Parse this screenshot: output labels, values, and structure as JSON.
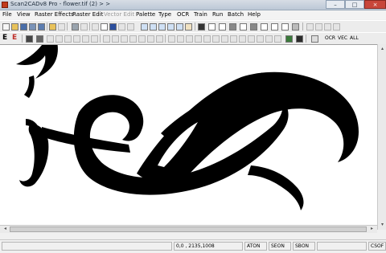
{
  "window": {
    "title": "Scan2CADv8 Pro - flower.tif (2) > >",
    "minimize_glyph": "–",
    "maximize_glyph": "□",
    "close_glyph": "×"
  },
  "menu": {
    "items": [
      {
        "label": "File",
        "enabled": true
      },
      {
        "label": "View",
        "enabled": true
      },
      {
        "label": "Raster Effects",
        "enabled": true
      },
      {
        "label": "Raster Edit",
        "enabled": true
      },
      {
        "label": "Vector Edit",
        "enabled": false
      },
      {
        "label": "Palette",
        "enabled": true
      },
      {
        "label": "Type",
        "enabled": true
      },
      {
        "label": "OCR",
        "enabled": true
      },
      {
        "label": "Train",
        "enabled": true
      },
      {
        "label": "Run",
        "enabled": true
      },
      {
        "label": "Batch",
        "enabled": true
      },
      {
        "label": "Help",
        "enabled": true
      }
    ]
  },
  "toolbar2": {
    "e_label": "E",
    "e_red_label": "E",
    "ocr_label": "OCR",
    "vec_label": "VEC",
    "all_label": "ALL"
  },
  "scroll": {
    "left_arrow": "◂",
    "right_arrow": "▸",
    "up_arrow": "▴",
    "down_arrow": "▾"
  },
  "status": {
    "coordinates": "0,0 , 2135,1008",
    "aton": "ATON",
    "seon": "SEON",
    "sbon": "SBON",
    "csof": "CSOF"
  },
  "colors": {
    "image_ink": "#000000",
    "canvas_bg": "#ffffff",
    "close_button": "#c8463a"
  }
}
